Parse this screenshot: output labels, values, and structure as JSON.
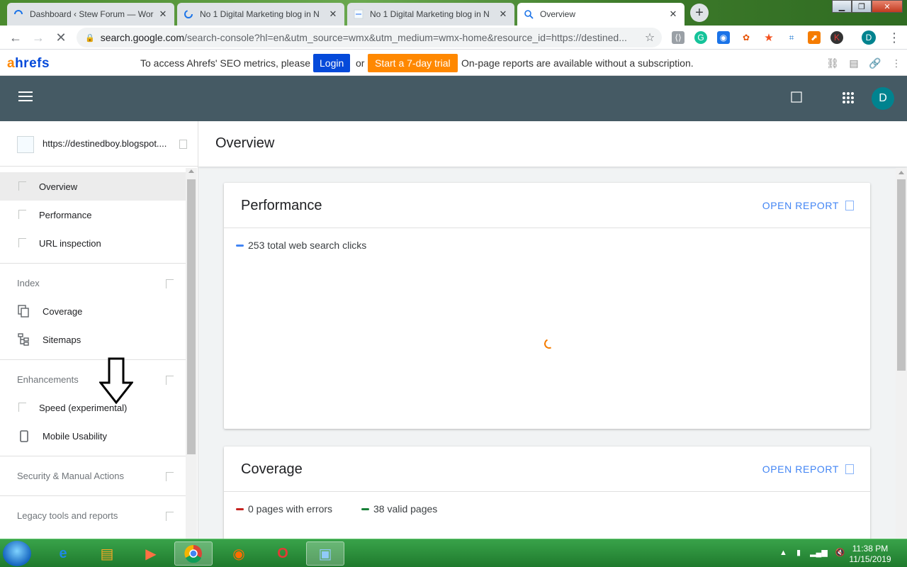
{
  "browser": {
    "tabs": [
      {
        "title": "Dashboard ‹ Stew Forum — Wor",
        "active": false
      },
      {
        "title": "No 1 Digital Marketing blog in N",
        "active": false
      },
      {
        "title": "No 1 Digital Marketing blog in N",
        "active": false
      },
      {
        "title": "Overview",
        "active": true
      }
    ],
    "url_host": "search.google.com",
    "url_rest": "/search-console?hl=en&utm_source=wmx&utm_medium=wmx-home&resource_id=https://destined...",
    "profile_initial": "D"
  },
  "ahrefs": {
    "logo_a": "a",
    "logo_rest": "hrefs",
    "message": "To access Ahrefs' SEO metrics, please",
    "login_label": "Login",
    "or_text": "or",
    "trial_label": "Start a 7-day trial",
    "message2": "On-page reports are available without a subscription."
  },
  "header": {
    "avatar_initial": "D"
  },
  "sidebar": {
    "property": "https://destinedboy.blogspot....",
    "items": [
      {
        "label": "Overview",
        "selected": true
      },
      {
        "label": "Performance"
      },
      {
        "label": "URL inspection"
      }
    ],
    "sections": [
      {
        "label": "Index",
        "items": [
          {
            "label": "Coverage"
          },
          {
            "label": "Sitemaps"
          }
        ]
      },
      {
        "label": "Enhancements",
        "items": [
          {
            "label": "Speed (experimental)"
          },
          {
            "label": "Mobile Usability"
          }
        ]
      },
      {
        "label": "Security & Manual Actions"
      },
      {
        "label": "Legacy tools and reports"
      }
    ]
  },
  "main": {
    "page_title": "Overview",
    "cards": [
      {
        "title": "Performance",
        "open_label": "OPEN REPORT",
        "legend": [
          {
            "text": "253 total web search clicks",
            "color": "#4285f4"
          }
        ]
      },
      {
        "title": "Coverage",
        "open_label": "OPEN REPORT",
        "legend": [
          {
            "text": "0 pages with errors",
            "color": "#c5221f"
          },
          {
            "text": "38 valid pages",
            "color": "#188038"
          }
        ]
      }
    ]
  },
  "taskbar": {
    "time": "11:38 PM",
    "date": "11/15/2019"
  },
  "colors": {
    "gsc_header": "#455a64",
    "link_blue": "#4285f4",
    "ahrefs_blue": "#054ada",
    "ahrefs_orange": "#ff8800"
  }
}
